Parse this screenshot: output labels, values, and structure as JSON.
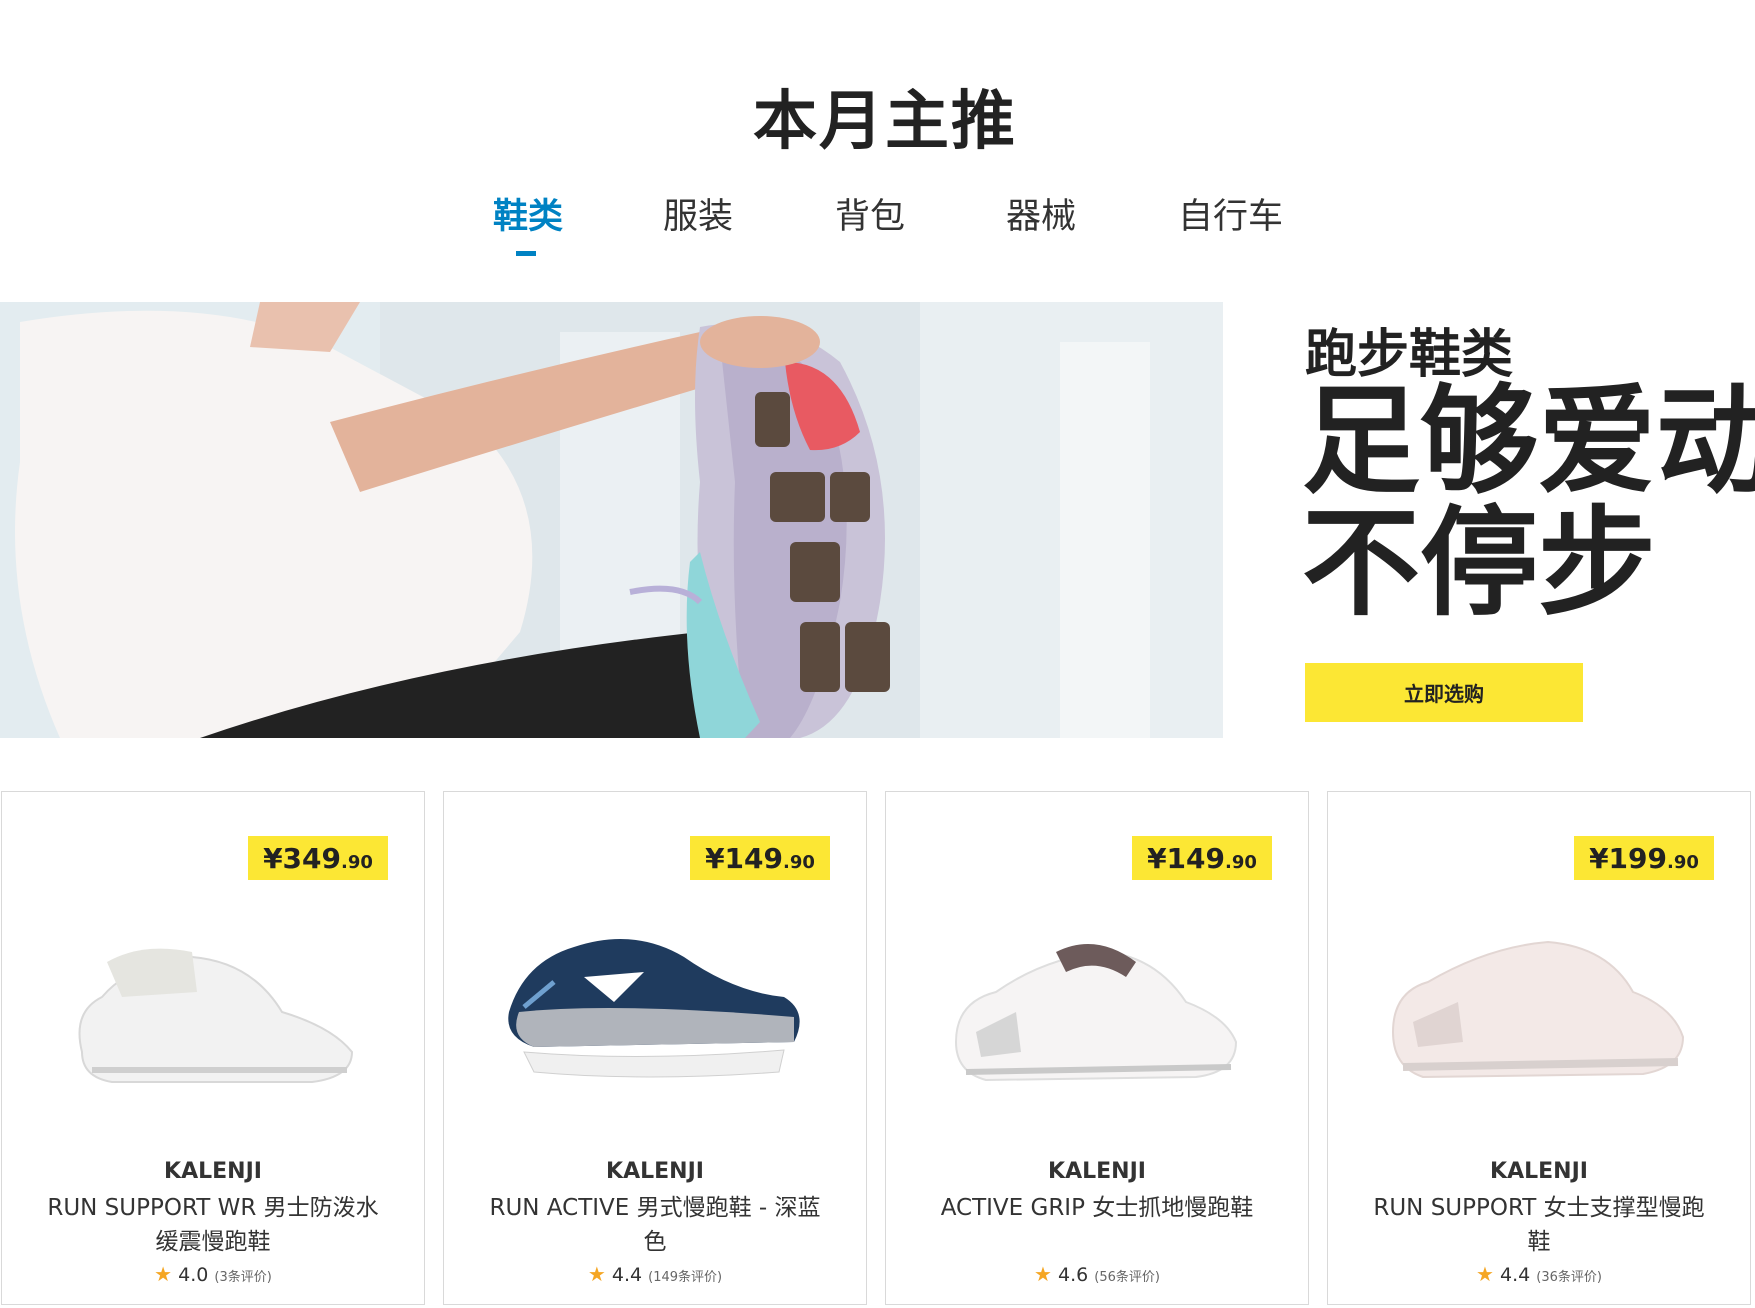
{
  "page": {
    "title": "本月主推"
  },
  "tabs": [
    {
      "label": "鞋类",
      "active": true
    },
    {
      "label": "服装",
      "active": false
    },
    {
      "label": "背包",
      "active": false
    },
    {
      "label": "器械",
      "active": false
    },
    {
      "label": "自行车",
      "active": false
    }
  ],
  "hero": {
    "kicker": "跑步鞋类",
    "headline_line1": "足够爱动",
    "headline_line2": "不停步",
    "cta_label": "立即选购"
  },
  "products": [
    {
      "price_main": "¥349",
      "price_dec": ".90",
      "brand": "KALENJI",
      "name": "RUN SUPPORT WR 男士防泼水缓震慢跑鞋",
      "rating": "4.0",
      "reviews": "(3条评价)",
      "color": "white"
    },
    {
      "price_main": "¥149",
      "price_dec": ".90",
      "brand": "KALENJI",
      "name": "RUN ACTIVE 男式慢跑鞋 - 深蓝色",
      "rating": "4.4",
      "reviews": "(149条评价)",
      "color": "navy"
    },
    {
      "price_main": "¥149",
      "price_dec": ".90",
      "brand": "KALENJI",
      "name": "ACTIVE GRIP 女士抓地慢跑鞋",
      "rating": "4.6",
      "reviews": "(56条评价)",
      "color": "white-pink"
    },
    {
      "price_main": "¥199",
      "price_dec": ".90",
      "brand": "KALENJI",
      "name": "RUN SUPPORT 女士支撑型慢跑鞋",
      "rating": "4.4",
      "reviews": "(36条评价)",
      "color": "pink"
    }
  ],
  "colors": {
    "accent_blue": "#0082c3",
    "accent_yellow": "#fce734",
    "star": "#f5a623"
  }
}
